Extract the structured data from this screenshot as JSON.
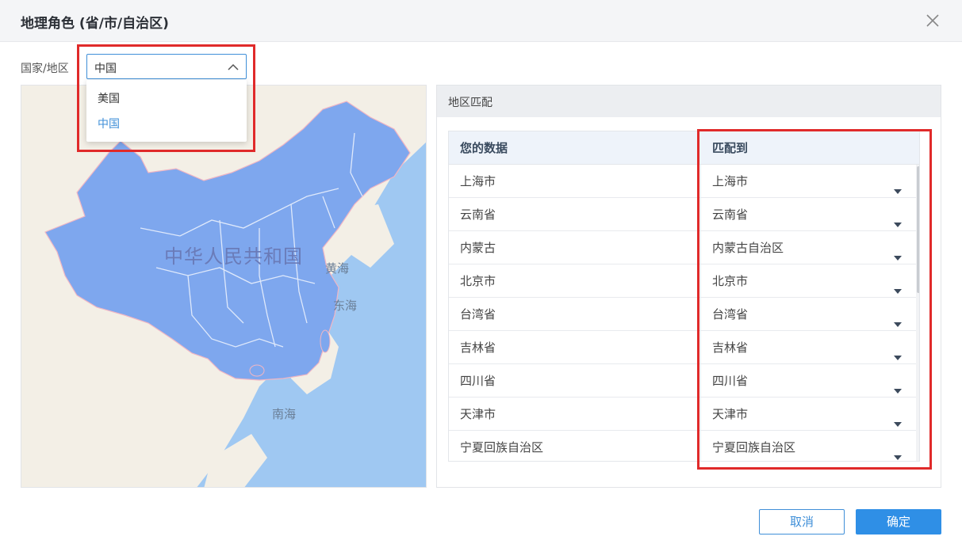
{
  "dialog": {
    "title": "地理角色 (省/市/自治区)"
  },
  "country": {
    "label": "国家/地区",
    "selected": "中国",
    "options": [
      "美国",
      "中国"
    ]
  },
  "map": {
    "country_label": "中华人民共和国",
    "seas": [
      "黄海",
      "东海",
      "南海"
    ]
  },
  "match": {
    "title": "地区匹配",
    "headers": {
      "yours": "您的数据",
      "match_to": "匹配到"
    },
    "rows": [
      {
        "yours": "上海市",
        "match": "上海市"
      },
      {
        "yours": "云南省",
        "match": "云南省"
      },
      {
        "yours": "内蒙古",
        "match": "内蒙古自治区"
      },
      {
        "yours": "北京市",
        "match": "北京市"
      },
      {
        "yours": "台湾省",
        "match": "台湾省"
      },
      {
        "yours": "吉林省",
        "match": "吉林省"
      },
      {
        "yours": "四川省",
        "match": "四川省"
      },
      {
        "yours": "天津市",
        "match": "天津市"
      },
      {
        "yours": "宁夏回族自治区",
        "match": "宁夏回族自治区"
      }
    ]
  },
  "buttons": {
    "cancel": "取消",
    "ok": "确定"
  },
  "colors": {
    "accent": "#2f8fe6",
    "highlight": "#e02a2a",
    "land": "#7ea7ee",
    "sea": "#9fc8f2"
  },
  "icons": {
    "close": "close-icon",
    "select_chevron": "chevron-up-icon",
    "row_caret": "caret-down-icon"
  }
}
